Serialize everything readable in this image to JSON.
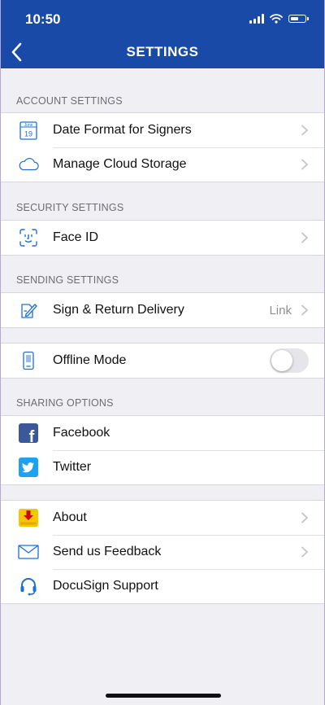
{
  "status_bar": {
    "time": "10:50"
  },
  "header": {
    "title": "SETTINGS"
  },
  "sections": {
    "account": {
      "label": "ACCOUNT SETTINGS",
      "items": [
        {
          "label": "Date Format for Signers",
          "icon": "calendar-icon",
          "icon_month": "June",
          "icon_day": "19"
        },
        {
          "label": "Manage Cloud Storage",
          "icon": "cloud-icon"
        }
      ]
    },
    "security": {
      "label": "SECURITY SETTINGS",
      "items": [
        {
          "label": "Face ID",
          "icon": "face-id-icon"
        }
      ]
    },
    "sending": {
      "label": "SENDING SETTINGS",
      "items": [
        {
          "label": "Sign & Return Delivery",
          "value": "Link",
          "icon": "pen-document-icon"
        }
      ]
    },
    "offline": {
      "items": [
        {
          "label": "Offline Mode",
          "icon": "offline-device-icon",
          "toggle_on": false
        }
      ]
    },
    "sharing": {
      "label": "SHARING OPTIONS",
      "items": [
        {
          "label": "Facebook",
          "icon": "facebook-icon",
          "glyph": "f"
        },
        {
          "label": "Twitter",
          "icon": "twitter-icon"
        }
      ]
    },
    "support": {
      "items": [
        {
          "label": "About",
          "icon": "download-arrow-icon"
        },
        {
          "label": "Send us Feedback",
          "icon": "envelope-icon"
        },
        {
          "label": "DocuSign Support",
          "icon": "headset-icon"
        }
      ]
    }
  },
  "colors": {
    "header": "#1a4aa8",
    "icon_blue": "#1e6fd0",
    "facebook": "#3b5998",
    "twitter": "#1da1f2",
    "about_yellow": "#f7c600",
    "about_red": "#d0021b"
  }
}
